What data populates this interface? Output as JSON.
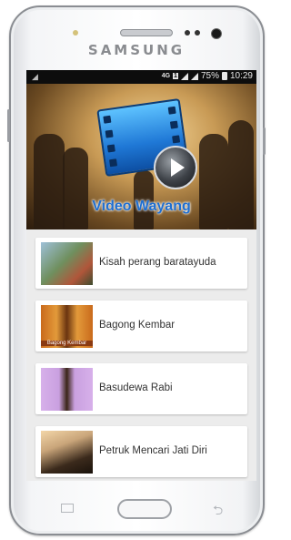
{
  "device": {
    "brand": "SAMSUNG"
  },
  "status_bar": {
    "network": "4G",
    "sim": "1",
    "battery": "75%",
    "time": "10:29"
  },
  "banner": {
    "title": "Video Wayang"
  },
  "list": {
    "items": [
      {
        "title": "Kisah perang baratayuda",
        "thumb_caption": ""
      },
      {
        "title": "Bagong Kembar",
        "thumb_caption": "Bagong Kembar"
      },
      {
        "title": "Basudewa Rabi",
        "thumb_caption": ""
      },
      {
        "title": "Petruk Mencari Jati Diri",
        "thumb_caption": ""
      }
    ]
  },
  "colors": {
    "banner_title": "#1f6fd1",
    "status_bar_bg": "#0d0d0d",
    "screen_bg": "#ececec"
  },
  "icons": [
    "play-icon",
    "film-icon",
    "signal-icon",
    "battery-icon",
    "recent-apps-icon",
    "back-icon"
  ]
}
